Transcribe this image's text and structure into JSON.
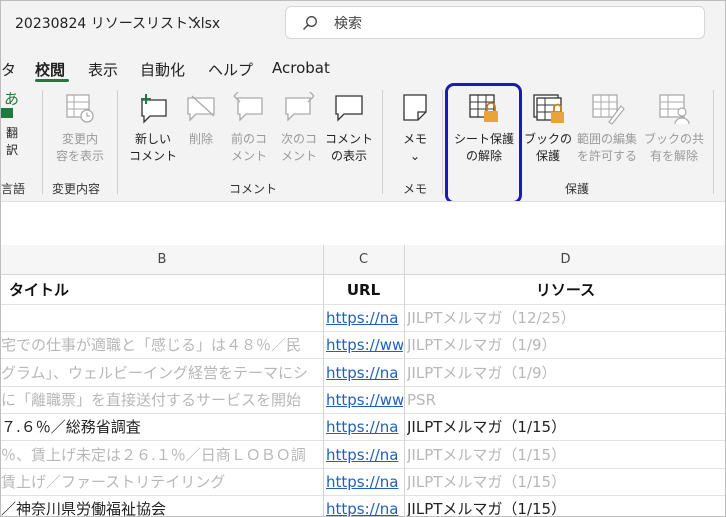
{
  "title_bar": {
    "filename": "20230824 リソースリスト.xlsx",
    "search_placeholder": "検索"
  },
  "tabs": [
    "タ",
    "校閲",
    "表示",
    "自動化",
    "ヘルプ",
    "Acrobat"
  ],
  "ribbon": {
    "lang_partial_top": "翻",
    "lang_partial_bottom": "訳",
    "show_changes": "変更内\n容を表示",
    "new_comment": "新しい\nコメント",
    "delete": "削除",
    "prev_comment": "前のコ\nメント",
    "next_comment": "次のコ\nメント",
    "show_comments": "コメント\nの表示",
    "memo": "メモ",
    "memo_chev": "⌄",
    "unprotect_sheet": "シート保護\nの解除",
    "protect_workbook": "ブックの\n保護",
    "allow_edit_ranges": "範囲の編集\nを許可する",
    "unshare_workbook": "ブックの共\n有を解除",
    "groups": {
      "lang": "言語",
      "changes": "変更内容",
      "comments": "コメント",
      "memo": "メモ",
      "protect": "保護"
    }
  },
  "grid": {
    "columns": [
      "B",
      "C",
      "D"
    ],
    "header_row": {
      "b": "タイトル",
      "c": "URL",
      "d": "リソース"
    },
    "rows": [
      {
        "b": "",
        "c": "https://na",
        "d": "JILPTメルマガ（12/25）",
        "dim": true
      },
      {
        "b": "宅での仕事が適職と「感じる」は４８％／民",
        "c": "https://ww",
        "d": "JILPTメルマガ（1/9）",
        "dim": true
      },
      {
        "b": "グラム」、ウェルビーイング経営をテーマにシ",
        "c": "https://na",
        "d": "JILPTメルマガ（1/9）",
        "dim": true
      },
      {
        "b": "に「離職票」を直接送付するサービスを開始",
        "c": "https://ww",
        "d": "PSR",
        "dim": true
      },
      {
        "b": "７.６％／総務省調査",
        "c": "https://na",
        "d": "JILPTメルマガ（1/15）",
        "dim": false
      },
      {
        "b": "％、賃上げ未定は２６.１％／日商ＬＯＢＯ調",
        "c": "https://na",
        "d": "JILPTメルマガ（1/15）",
        "dim": true
      },
      {
        "b": "賃上げ／ファーストリテイリング",
        "c": "https://na",
        "d": "JILPTメルマガ（1/15）",
        "dim": true
      },
      {
        "b": "／神奈川県労働福祉協会",
        "c": "https://na",
        "d": "JILPTメルマガ（1/15）",
        "dim": false
      }
    ]
  },
  "colors": {
    "accent_tab": "#1f7a3f",
    "highlight": "#1a1ab8",
    "link": "#1f5fbf"
  }
}
